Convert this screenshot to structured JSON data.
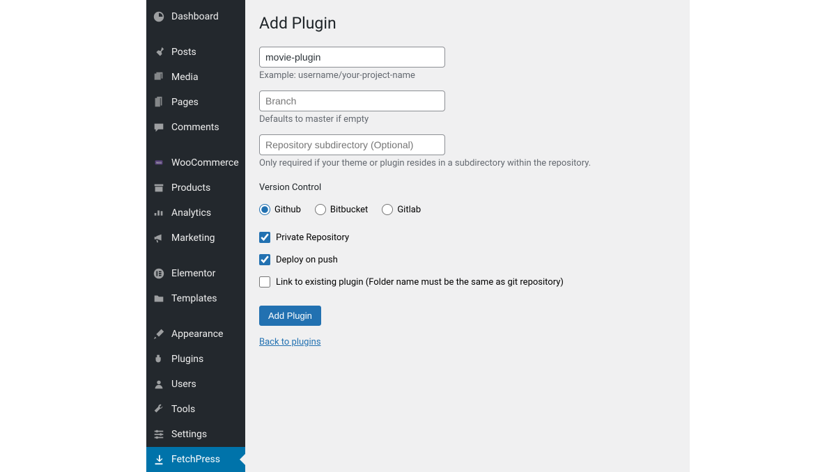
{
  "sidebar": {
    "items": [
      {
        "label": "Dashboard"
      },
      {
        "label": "Posts"
      },
      {
        "label": "Media"
      },
      {
        "label": "Pages"
      },
      {
        "label": "Comments"
      },
      {
        "label": "WooCommerce"
      },
      {
        "label": "Products"
      },
      {
        "label": "Analytics"
      },
      {
        "label": "Marketing"
      },
      {
        "label": "Elementor"
      },
      {
        "label": "Templates"
      },
      {
        "label": "Appearance"
      },
      {
        "label": "Plugins"
      },
      {
        "label": "Users"
      },
      {
        "label": "Tools"
      },
      {
        "label": "Settings"
      },
      {
        "label": "FetchPress"
      }
    ]
  },
  "main": {
    "title": "Add Plugin",
    "repo_input": {
      "value": "movie-plugin",
      "help": "Example: username/your-project-name"
    },
    "branch_input": {
      "placeholder": "Branch",
      "help": "Defaults to master if empty"
    },
    "subdir_input": {
      "placeholder": "Repository subdirectory (Optional)",
      "help": "Only required if your theme or plugin resides in a subdirectory within the repository."
    },
    "vc_label": "Version Control",
    "vc_options": {
      "github": "Github",
      "bitbucket": "Bitbucket",
      "gitlab": "Gitlab"
    },
    "private_repo_label": "Private Repository",
    "deploy_push_label": "Deploy on push",
    "link_existing_label": "Link to existing plugin (Folder name must be the same as git repository)",
    "submit_label": "Add Plugin",
    "back_link": "Back to plugins"
  }
}
